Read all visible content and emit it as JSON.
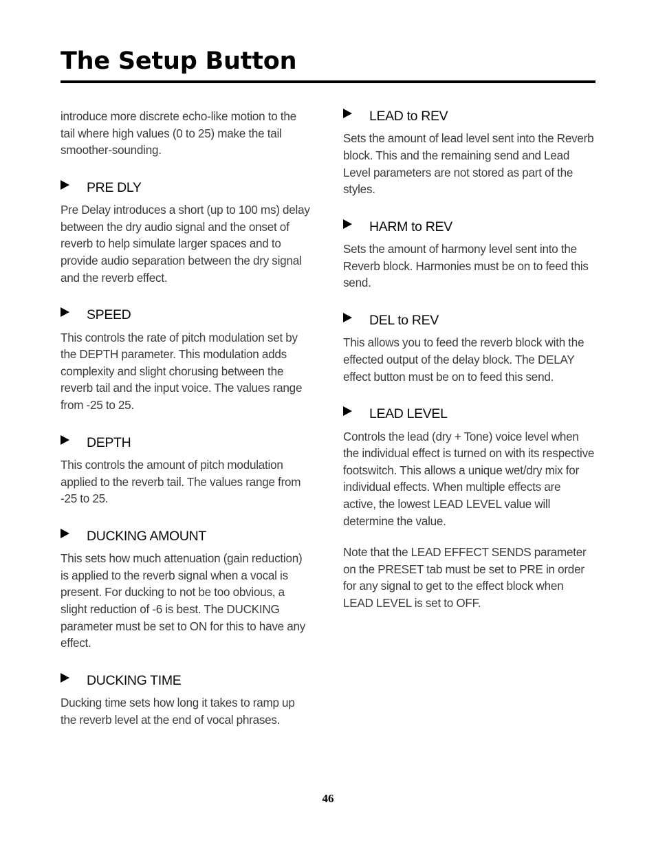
{
  "document": {
    "title": "The Setup Button",
    "page_number": "46"
  },
  "icons": {
    "bullet": "triangle-right-icon"
  },
  "colors": {
    "title_text": "#000000",
    "heading_text": "#0a0a0a",
    "body_text": "#3b3b3b",
    "rule": "#000000",
    "background": "#ffffff"
  },
  "left_column": {
    "intro_paragraph": "introduce more discrete echo-like motion to the tail where high values (0 to 25) make the tail smoother-sounding.",
    "sections": [
      {
        "heading": "PRE DLY",
        "paragraphs": [
          "Pre Delay introduces a short (up to 100 ms) delay between the dry audio signal and the onset of reverb to help simulate larger spaces and to provide audio separation between the dry signal and the reverb effect."
        ]
      },
      {
        "heading": "SPEED",
        "paragraphs": [
          "This controls the rate of pitch modulation set by the DEPTH parameter. This modulation adds complexity and slight chorusing between the reverb tail and the input voice. The values range from -25 to 25."
        ]
      },
      {
        "heading": "DEPTH",
        "paragraphs": [
          "This controls the amount of pitch modulation applied to the reverb tail. The values range from -25 to 25."
        ]
      },
      {
        "heading": "DUCKING AMOUNT",
        "paragraphs": [
          "This sets how much attenuation (gain reduction) is applied to the reverb signal when a vocal is present. For ducking to not be too obvious, a slight reduction of -6  is best. The DUCKING parameter must be set to ON for this to have any effect."
        ]
      },
      {
        "heading": "DUCKING TIME",
        "paragraphs": [
          "Ducking time sets how long it takes to ramp up the reverb level at the end of vocal phrases."
        ]
      }
    ]
  },
  "right_column": {
    "sections": [
      {
        "heading": "LEAD to REV",
        "paragraphs": [
          "Sets the amount of lead level sent into the Reverb block. This and the remaining send and Lead Level parameters are not stored as part of the styles."
        ]
      },
      {
        "heading": "HARM to REV",
        "paragraphs": [
          "Sets the amount of harmony level sent into the Reverb block. Harmonies must be on to feed this send."
        ]
      },
      {
        "heading": "DEL to REV",
        "paragraphs": [
          "This allows you to feed the reverb block with the effected output of the delay block. The DELAY effect button must be on to feed this send."
        ]
      },
      {
        "heading": "LEAD LEVEL",
        "paragraphs": [
          "Controls the lead (dry + Tone) voice level when the individual effect is turned on with its respective footswitch. This allows a unique wet/dry mix for individual effects. When multiple effects are active, the lowest LEAD LEVEL value will determine the value.",
          "Note that the LEAD EFFECT SENDS parameter on the PRESET tab must be set to PRE in order for any signal to get to the effect block when LEAD LEVEL is set to OFF."
        ]
      }
    ]
  }
}
